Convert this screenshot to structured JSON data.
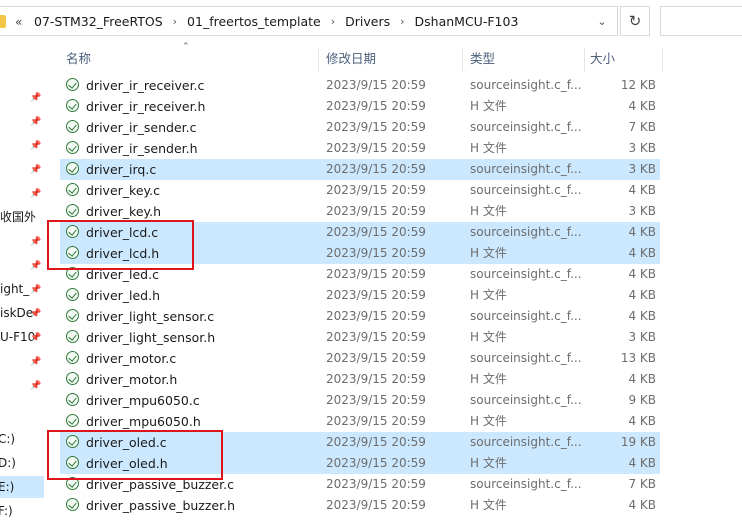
{
  "address": {
    "back_label": "«",
    "breadcrumbs": [
      "07-STM32_FreeRTOS",
      "01_freertos_template",
      "Drivers",
      "DshanMCU-F103"
    ],
    "separator": "›"
  },
  "columns": {
    "name": "名称",
    "date": "修改日期",
    "type": "类型",
    "size": "大小"
  },
  "nav": {
    "partial_items": [
      "收国外",
      "ight_",
      "iskDe",
      "U-F10",
      "C:)",
      "D:)",
      "E:)",
      "F:)"
    ]
  },
  "files": [
    {
      "name": "driver_ir_receiver.c",
      "date": "2023/9/15 20:59",
      "type": "sourceinsight.c_f...",
      "size": "12 KB",
      "selected": false
    },
    {
      "name": "driver_ir_receiver.h",
      "date": "2023/9/15 20:59",
      "type": "H 文件",
      "size": "4 KB",
      "selected": false
    },
    {
      "name": "driver_ir_sender.c",
      "date": "2023/9/15 20:59",
      "type": "sourceinsight.c_f...",
      "size": "7 KB",
      "selected": false
    },
    {
      "name": "driver_ir_sender.h",
      "date": "2023/9/15 20:59",
      "type": "H 文件",
      "size": "3 KB",
      "selected": false
    },
    {
      "name": "driver_irq.c",
      "date": "2023/9/15 20:59",
      "type": "sourceinsight.c_f...",
      "size": "3 KB",
      "selected": true
    },
    {
      "name": "driver_key.c",
      "date": "2023/9/15 20:59",
      "type": "sourceinsight.c_f...",
      "size": "4 KB",
      "selected": false
    },
    {
      "name": "driver_key.h",
      "date": "2023/9/15 20:59",
      "type": "H 文件",
      "size": "3 KB",
      "selected": false
    },
    {
      "name": "driver_lcd.c",
      "date": "2023/9/15 20:59",
      "type": "sourceinsight.c_f...",
      "size": "4 KB",
      "selected": true
    },
    {
      "name": "driver_lcd.h",
      "date": "2023/9/15 20:59",
      "type": "H 文件",
      "size": "4 KB",
      "selected": true
    },
    {
      "name": "driver_led.c",
      "date": "2023/9/15 20:59",
      "type": "sourceinsight.c_f...",
      "size": "4 KB",
      "selected": false
    },
    {
      "name": "driver_led.h",
      "date": "2023/9/15 20:59",
      "type": "H 文件",
      "size": "4 KB",
      "selected": false
    },
    {
      "name": "driver_light_sensor.c",
      "date": "2023/9/15 20:59",
      "type": "sourceinsight.c_f...",
      "size": "4 KB",
      "selected": false
    },
    {
      "name": "driver_light_sensor.h",
      "date": "2023/9/15 20:59",
      "type": "H 文件",
      "size": "3 KB",
      "selected": false
    },
    {
      "name": "driver_motor.c",
      "date": "2023/9/15 20:59",
      "type": "sourceinsight.c_f...",
      "size": "13 KB",
      "selected": false
    },
    {
      "name": "driver_motor.h",
      "date": "2023/9/15 20:59",
      "type": "H 文件",
      "size": "4 KB",
      "selected": false
    },
    {
      "name": "driver_mpu6050.c",
      "date": "2023/9/15 20:59",
      "type": "sourceinsight.c_f...",
      "size": "9 KB",
      "selected": false
    },
    {
      "name": "driver_mpu6050.h",
      "date": "2023/9/15 20:59",
      "type": "H 文件",
      "size": "4 KB",
      "selected": false
    },
    {
      "name": "driver_oled.c",
      "date": "2023/9/15 20:59",
      "type": "sourceinsight.c_f...",
      "size": "19 KB",
      "selected": true
    },
    {
      "name": "driver_oled.h",
      "date": "2023/9/15 20:59",
      "type": "H 文件",
      "size": "4 KB",
      "selected": true
    },
    {
      "name": "driver_passive_buzzer.c",
      "date": "2023/9/15 20:59",
      "type": "sourceinsight.c_f...",
      "size": "7 KB",
      "selected": false
    },
    {
      "name": "driver_passive_buzzer.h",
      "date": "2023/9/15 20:59",
      "type": "H 文件",
      "size": "4 KB",
      "selected": false
    }
  ]
}
